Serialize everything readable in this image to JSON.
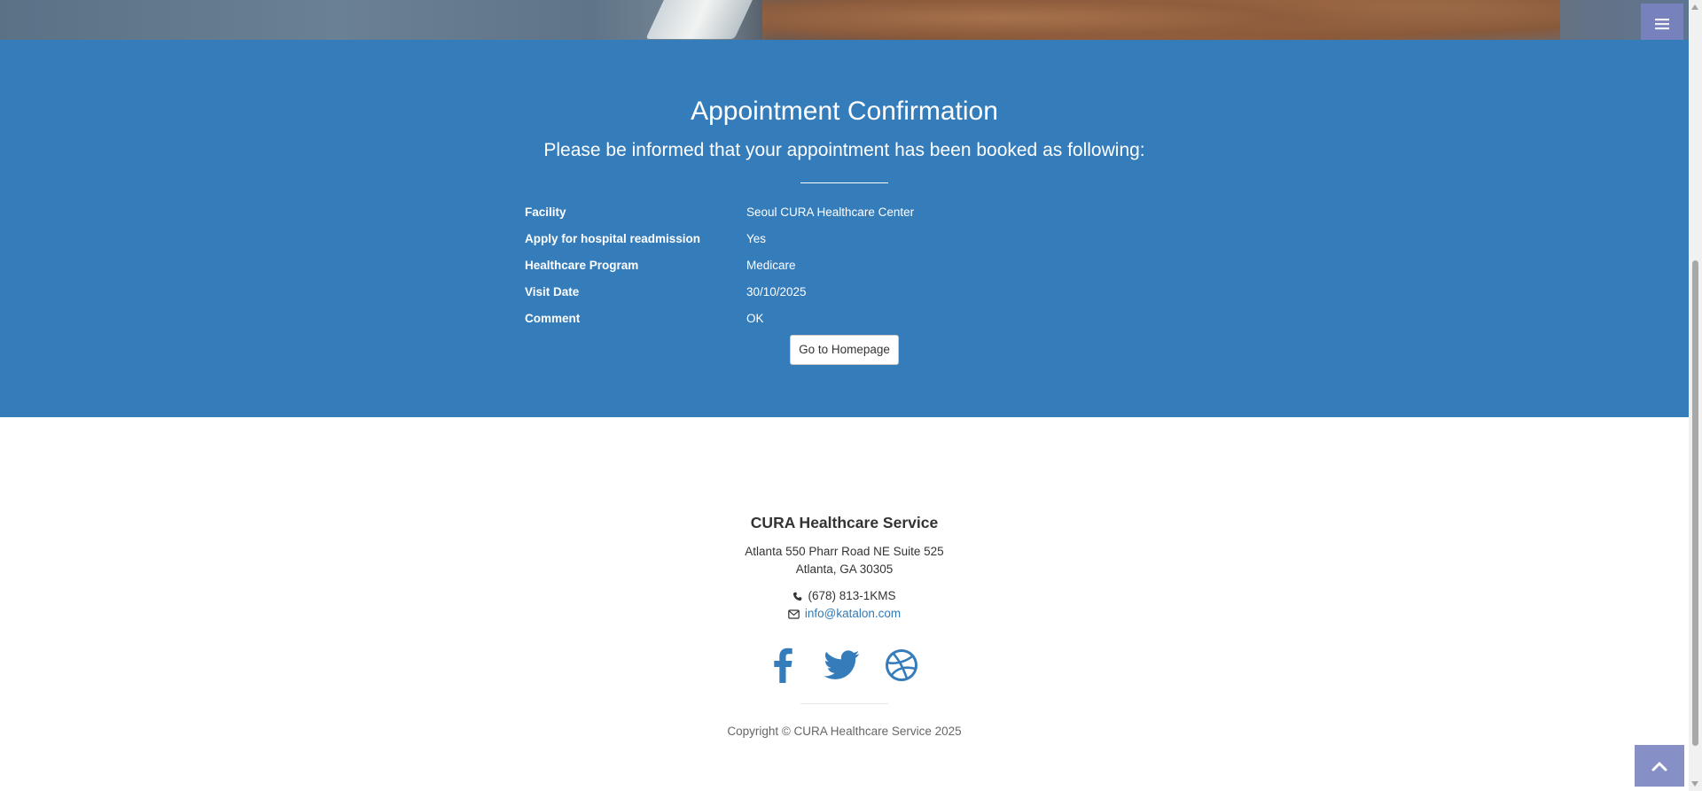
{
  "appointment": {
    "title": "Appointment Confirmation",
    "subtitle": "Please be informed that your appointment has been booked as following:",
    "details": [
      {
        "label": "Facility",
        "value": "Seoul CURA Healthcare Center"
      },
      {
        "label": "Apply for hospital readmission",
        "value": "Yes"
      },
      {
        "label": "Healthcare Program",
        "value": "Medicare"
      },
      {
        "label": "Visit Date",
        "value": "30/10/2025"
      },
      {
        "label": "Comment",
        "value": "OK"
      }
    ],
    "home_button": "Go to Homepage"
  },
  "footer": {
    "company": "CURA Healthcare Service",
    "address_line1": "Atlanta 550 Pharr Road NE Suite 525",
    "address_line2": "Atlanta, GA 30305",
    "phone": "(678) 813-1KMS",
    "email": "info@katalon.com",
    "copyright": "Copyright © CURA Healthcare Service 2025",
    "social_icons": [
      "facebook-icon",
      "twitter-icon",
      "dribbble-icon"
    ]
  },
  "icons": {
    "menu": "hamburger-menu-icon",
    "scroll_top": "chevron-up-icon",
    "phone": "phone-icon",
    "email": "envelope-icon"
  },
  "colors": {
    "section_blue": "#357cbb",
    "accent_purple": "#7a84c2",
    "link_blue": "#337ab7"
  }
}
